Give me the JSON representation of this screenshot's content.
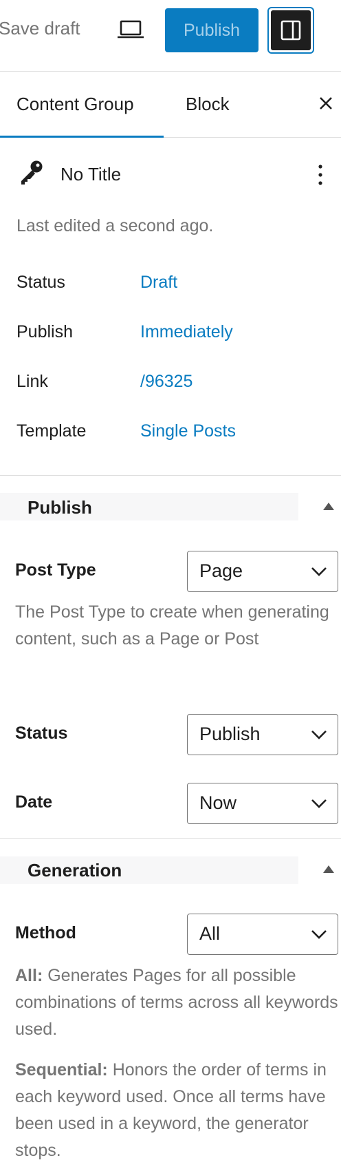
{
  "toolbar": {
    "save_draft_label": "Save draft",
    "preview_icon": "laptop-icon",
    "publish_label": "Publish",
    "settings_icon": "sidebar-toggle-icon",
    "accent_color": "#0a7cc1"
  },
  "tabs": {
    "items": [
      {
        "label": "Content Group"
      },
      {
        "label": "Block"
      }
    ],
    "active_index": 0,
    "close_icon": "close-icon"
  },
  "summary": {
    "icon": "key-icon",
    "title": "No Title",
    "more_icon": "more-vertical-icon",
    "last_edited": "Last edited a second ago.",
    "rows": [
      {
        "label": "Status",
        "value": "Draft"
      },
      {
        "label": "Publish",
        "value": "Immediately"
      },
      {
        "label": "Link",
        "value": "/96325"
      },
      {
        "label": "Template",
        "value": "Single Posts"
      }
    ]
  },
  "publish_panel": {
    "title": "Publish",
    "post_type": {
      "label": "Post Type",
      "value": "Page",
      "help": "The Post Type to create when generating content, such as a Page or Post"
    },
    "status": {
      "label": "Status",
      "value": "Publish"
    },
    "date": {
      "label": "Date",
      "value": "Now"
    }
  },
  "generation_panel": {
    "title": "Generation",
    "method": {
      "label": "Method",
      "value": "All"
    },
    "help_all_term": "All:",
    "help_all_text": " Generates Pages for all possible combinations of terms across all keywords used.",
    "help_seq_term": "Sequential:",
    "help_seq_text": " Honors the order of terms in each keyword used. Once all terms have been used in a keyword, the generator stops."
  }
}
